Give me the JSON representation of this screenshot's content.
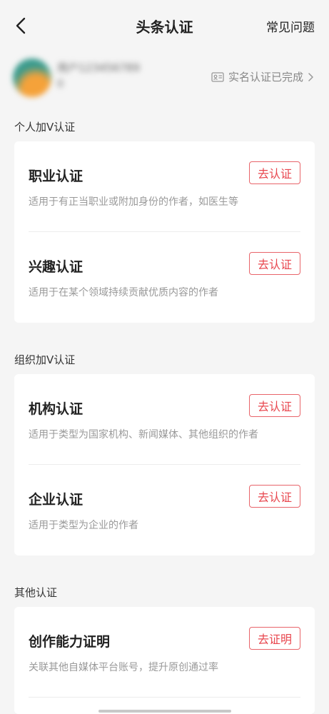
{
  "header": {
    "title": "头条认证",
    "faq_label": "常见问题"
  },
  "profile": {
    "name": "用户123456789",
    "sub": "0",
    "status_label": "实名认证已完成"
  },
  "sections": [
    {
      "title": "个人加V认证",
      "items": [
        {
          "title": "职业认证",
          "desc": "适用于有正当职业或附加身份的作者，如医生等",
          "button": "去认证"
        },
        {
          "title": "兴趣认证",
          "desc": "适用于在某个领域持续贡献优质内容的作者",
          "button": "去认证"
        }
      ]
    },
    {
      "title": "组织加V认证",
      "items": [
        {
          "title": "机构认证",
          "desc": "适用于类型为国家机构、新闻媒体、其他组织的作者",
          "button": "去认证"
        },
        {
          "title": "企业认证",
          "desc": "适用于类型为企业的作者",
          "button": "去认证"
        }
      ]
    },
    {
      "title": "其他认证",
      "items": [
        {
          "title": "创作能力证明",
          "desc": "关联其他自媒体平台账号，提升原创通过率",
          "button": "去证明"
        }
      ]
    }
  ]
}
